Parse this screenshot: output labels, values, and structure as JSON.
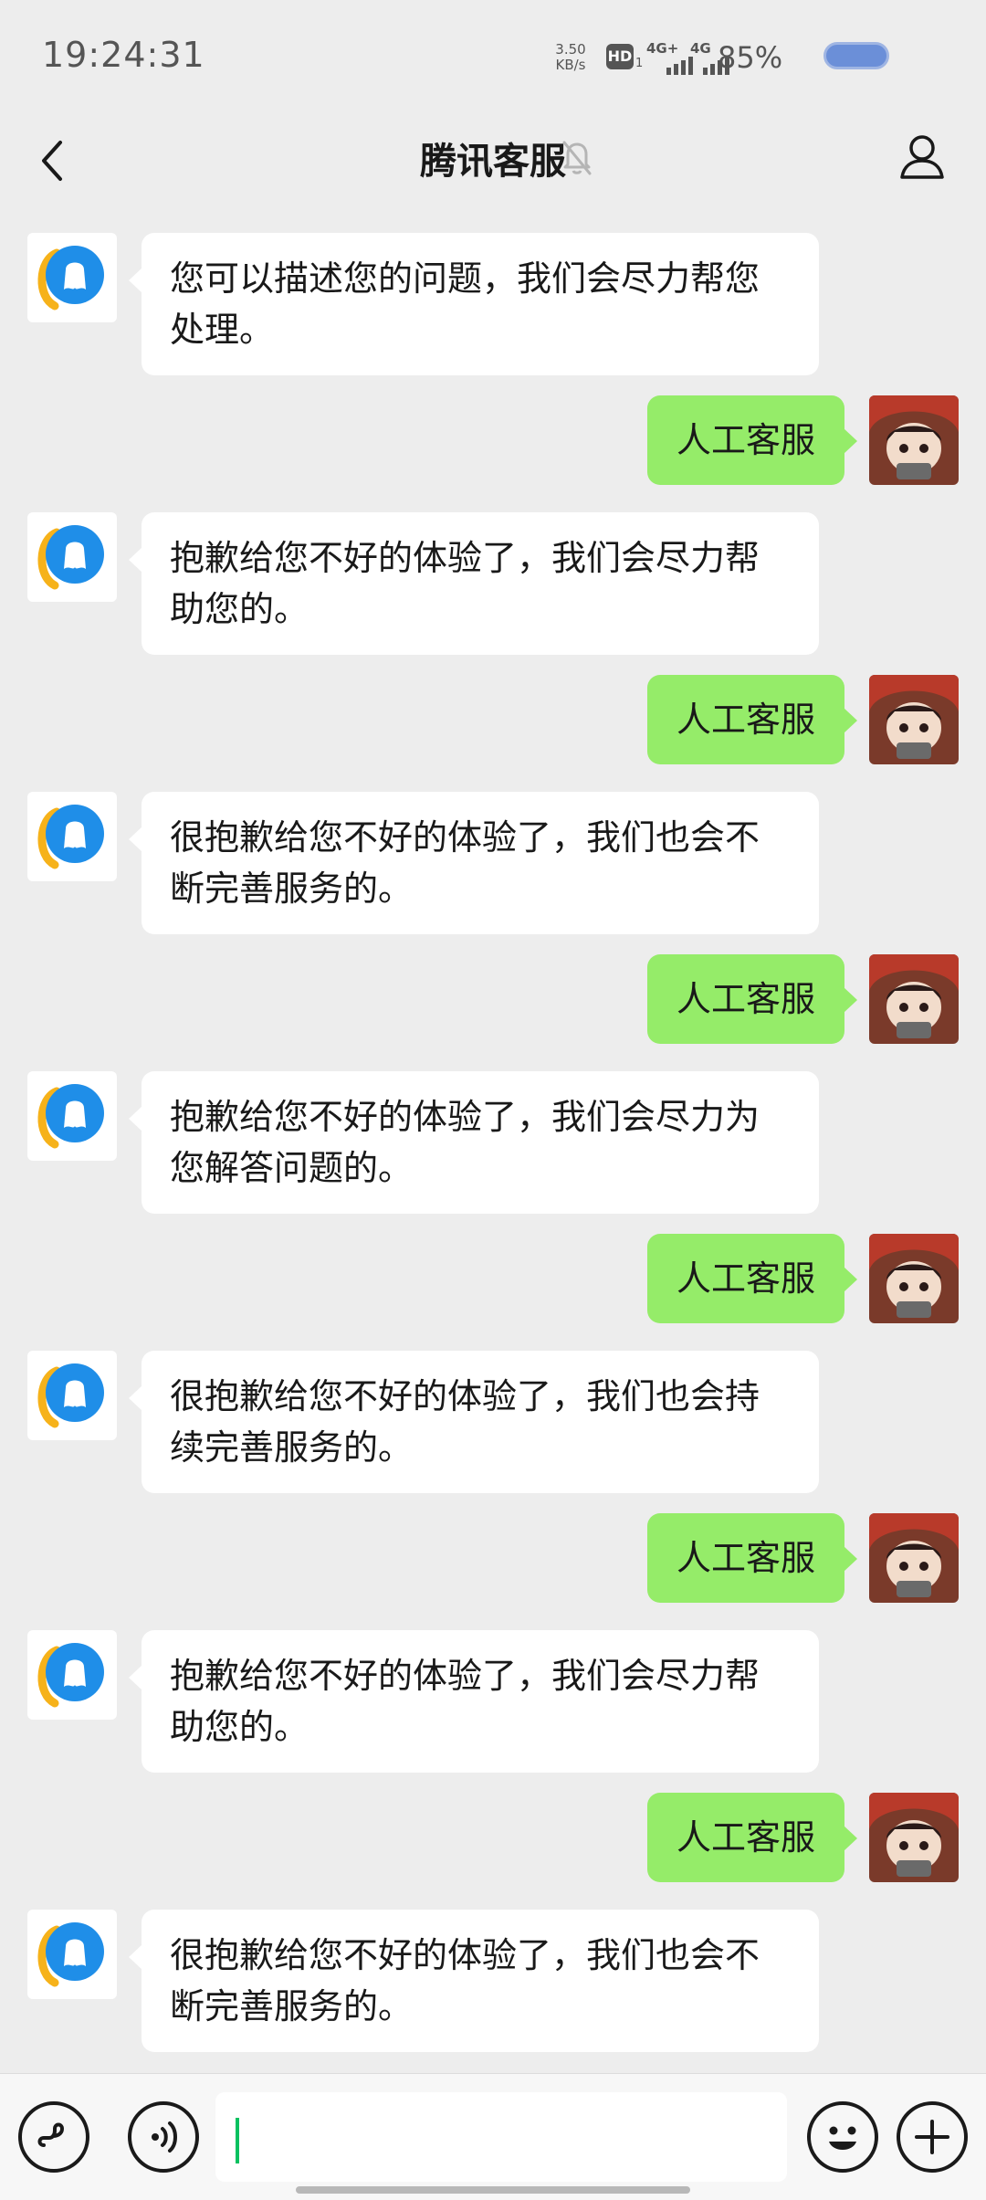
{
  "status_bar": {
    "time": "19:24:31",
    "net_speed_value": "3.50",
    "net_speed_unit": "KB/s",
    "hd_label": "HD",
    "hd_sub": "1",
    "signal1_label": "4G+",
    "signal2_label": "4G",
    "battery_percent": "85%",
    "battery_level": 0.85
  },
  "header": {
    "title": "腾讯客服"
  },
  "messages": [
    {
      "from": "bot",
      "text": "您可以描述您的问题，我们会尽力帮您处理。"
    },
    {
      "from": "user",
      "text": "人工客服"
    },
    {
      "from": "bot",
      "text": "抱歉给您不好的体验了，我们会尽力帮助您的。"
    },
    {
      "from": "user",
      "text": "人工客服"
    },
    {
      "from": "bot",
      "text": "很抱歉给您不好的体验了，我们也会不断完善服务的。"
    },
    {
      "from": "user",
      "text": "人工客服"
    },
    {
      "from": "bot",
      "text": "抱歉给您不好的体验了，我们会尽力为您解答问题的。"
    },
    {
      "from": "user",
      "text": "人工客服"
    },
    {
      "from": "bot",
      "text": "很抱歉给您不好的体验了，我们也会持续完善服务的。"
    },
    {
      "from": "user",
      "text": "人工客服"
    },
    {
      "from": "bot",
      "text": "抱歉给您不好的体验了，我们会尽力帮助您的。"
    },
    {
      "from": "user",
      "text": "人工客服"
    },
    {
      "from": "bot",
      "text": "很抱歉给您不好的体验了，我们也会不断完善服务的。"
    }
  ],
  "input_bar": {
    "message_value": "",
    "icons": [
      "mini-program-icon",
      "voice-icon",
      "emoji-icon",
      "plus-icon"
    ]
  },
  "colors": {
    "background": "#ededed",
    "outgoing_bubble": "#95ec69",
    "incoming_bubble": "#ffffff",
    "caret": "#07c160",
    "bot_avatar_blue": "#1f8ee8",
    "bot_avatar_yellow": "#f6b21a"
  }
}
